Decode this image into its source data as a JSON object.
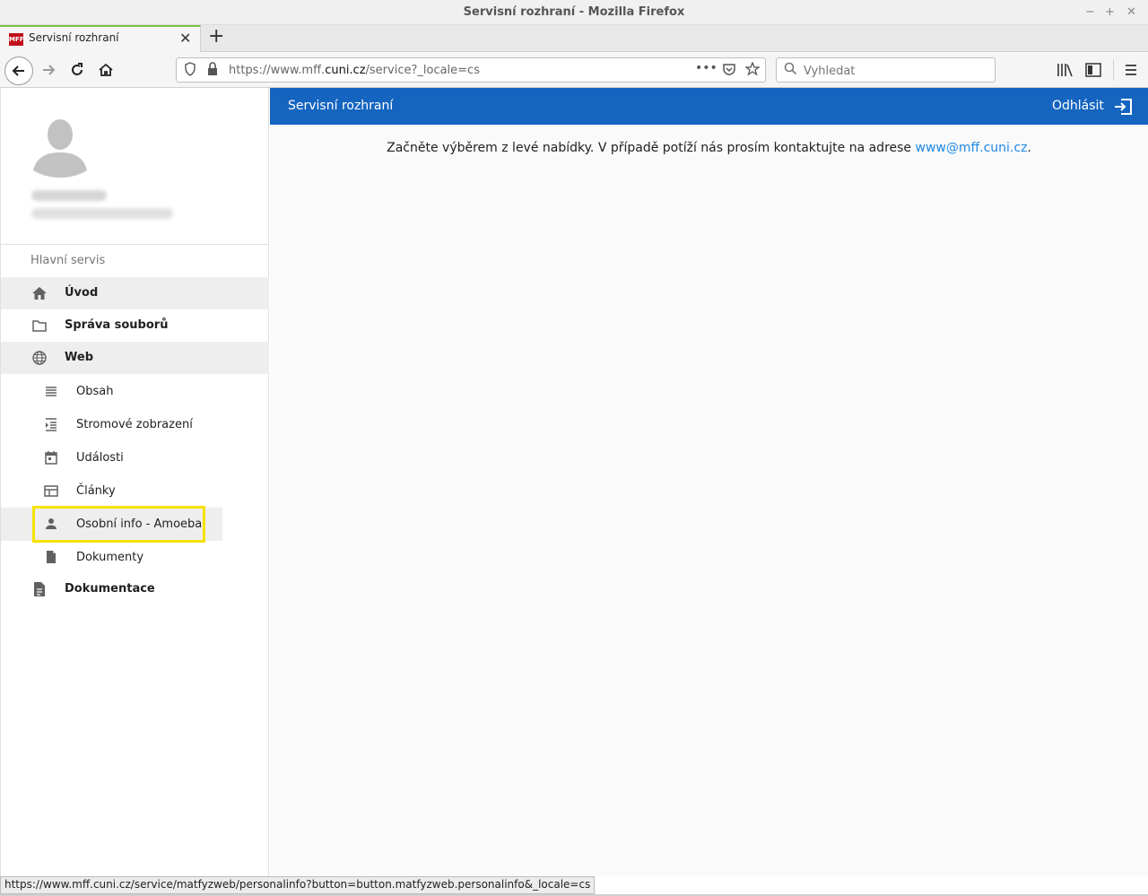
{
  "window": {
    "title": "Servisní rozhraní - Mozilla Firefox",
    "controls": [
      "−",
      "+",
      "✕"
    ]
  },
  "tab": {
    "favicon_text": "MFF",
    "title": "Servisní rozhraní",
    "close": "✕",
    "new_tab": "+"
  },
  "navbar": {
    "url_prefix": "https://www.mff.",
    "url_domain": "cuni.cz",
    "url_suffix": "/service?_locale=cs",
    "search_placeholder": "Vyhledat",
    "page_actions": "•••"
  },
  "profile": {},
  "sidebar": {
    "section_label": "Hlavní servis",
    "items": [
      {
        "label": "Úvod",
        "icon": "home-icon",
        "active": true
      },
      {
        "label": "Správa souborů",
        "icon": "folder-icon"
      },
      {
        "label": "Web",
        "icon": "globe-icon",
        "active": true
      }
    ],
    "web_subitems": [
      {
        "label": "Obsah",
        "icon": "list-icon"
      },
      {
        "label": "Stromové zobrazení",
        "icon": "tree-view-icon"
      },
      {
        "label": "Události",
        "icon": "calendar-icon"
      },
      {
        "label": "Články",
        "icon": "article-icon"
      },
      {
        "label": "Osobní info - Amoeba",
        "icon": "person-icon",
        "highlighted": true
      },
      {
        "label": "Dokumenty",
        "icon": "document-icon"
      }
    ],
    "bottom_item": {
      "label": "Dokumentace",
      "icon": "description-icon"
    }
  },
  "appbar": {
    "title": "Servisní rozhraní",
    "logout_label": "Odhlásit"
  },
  "content": {
    "message": "Začněte výběrem z levé nabídky. V případě potíží nás prosím kontaktujte na adrese ",
    "email": "www@mff.cuni.cz",
    "message_end": "."
  },
  "statusbar": {
    "link": "https://www.mff.cuni.cz/service/matfyzweb/personalinfo?button=button.matfyzweb.personalinfo&_locale=cs"
  },
  "colors": {
    "appbar": "#1565c0",
    "link": "#1e88e5",
    "highlight": "#f5e100"
  }
}
